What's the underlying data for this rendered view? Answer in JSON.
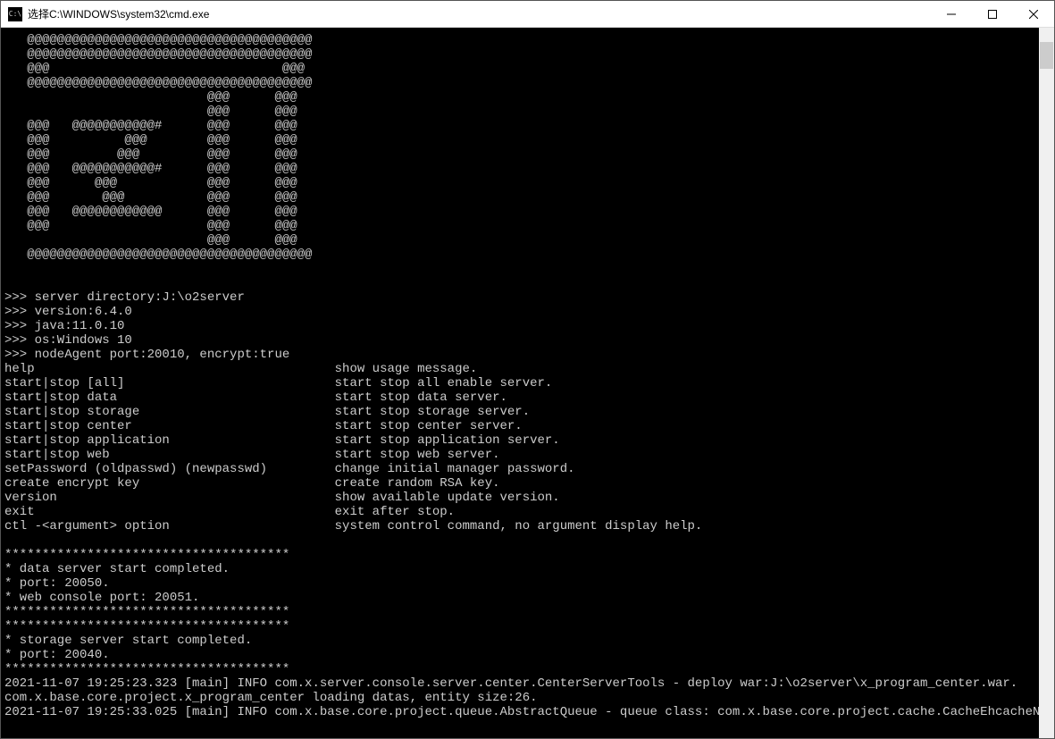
{
  "titlebar": {
    "icon_text": "C:\\",
    "title": "选择C:\\WINDOWS\\system32\\cmd.exe"
  },
  "terminal": {
    "ascii_art": [
      "   @@@@@@@@@@@@@@@@@@@@@@@@@@@@@@@@@@@@@@",
      "   @@@@@@@@@@@@@@@@@@@@@@@@@@@@@@@@@@@@@@",
      "   @@@                               @@@",
      "   @@@@@@@@@@@@@@@@@@@@@@@@@@@@@@@@@@@@@@",
      "                           @@@      @@@",
      "                           @@@      @@@",
      "   @@@   @@@@@@@@@@@#      @@@      @@@",
      "   @@@          @@@        @@@      @@@",
      "   @@@         @@@         @@@      @@@",
      "   @@@   @@@@@@@@@@@#      @@@      @@@",
      "   @@@      @@@            @@@      @@@",
      "   @@@       @@@           @@@      @@@",
      "   @@@   @@@@@@@@@@@@      @@@      @@@",
      "   @@@                     @@@      @@@",
      "                           @@@      @@@",
      "   @@@@@@@@@@@@@@@@@@@@@@@@@@@@@@@@@@@@@@"
    ],
    "info_lines": [
      ">>> server directory:J:\\o2server",
      ">>> version:6.4.0",
      ">>> java:11.0.10",
      ">>> os:Windows 10",
      ">>> nodeAgent port:20010, encrypt:true"
    ],
    "help_table": [
      [
        "help",
        "show usage message."
      ],
      [
        "start|stop [all]",
        "start stop all enable server."
      ],
      [
        "start|stop data",
        "start stop data server."
      ],
      [
        "start|stop storage",
        "start stop storage server."
      ],
      [
        "start|stop center",
        "start stop center server."
      ],
      [
        "start|stop application",
        "start stop application server."
      ],
      [
        "start|stop web",
        "start stop web server."
      ],
      [
        "setPassword (oldpasswd) (newpasswd)",
        "change initial manager password."
      ],
      [
        "create encrypt key",
        "create random RSA key."
      ],
      [
        "version",
        "show available update version."
      ],
      [
        "exit",
        "exit after stop."
      ],
      [
        "ctl -<argument> option",
        "system control command, no argument display help."
      ]
    ],
    "status_block1": [
      "**************************************",
      "* data server start completed.",
      "* port: 20050.",
      "* web console port: 20051.",
      "**************************************"
    ],
    "status_block2": [
      "**************************************",
      "* storage server start completed.",
      "* port: 20040.",
      "**************************************"
    ],
    "log_lines": [
      "2021-11-07 19:25:23.323 [main] INFO com.x.server.console.server.center.CenterServerTools - deploy war:J:\\o2server\\x_program_center.war.",
      "com.x.base.core.project.x_program_center loading datas, entity size:26.",
      "2021-11-07 19:25:33.025 [main] INFO com.x.base.core.project.queue.AbstractQueue - queue class: com.x.base.core.project.cache.CacheEhcacheNotifyRec"
    ]
  }
}
